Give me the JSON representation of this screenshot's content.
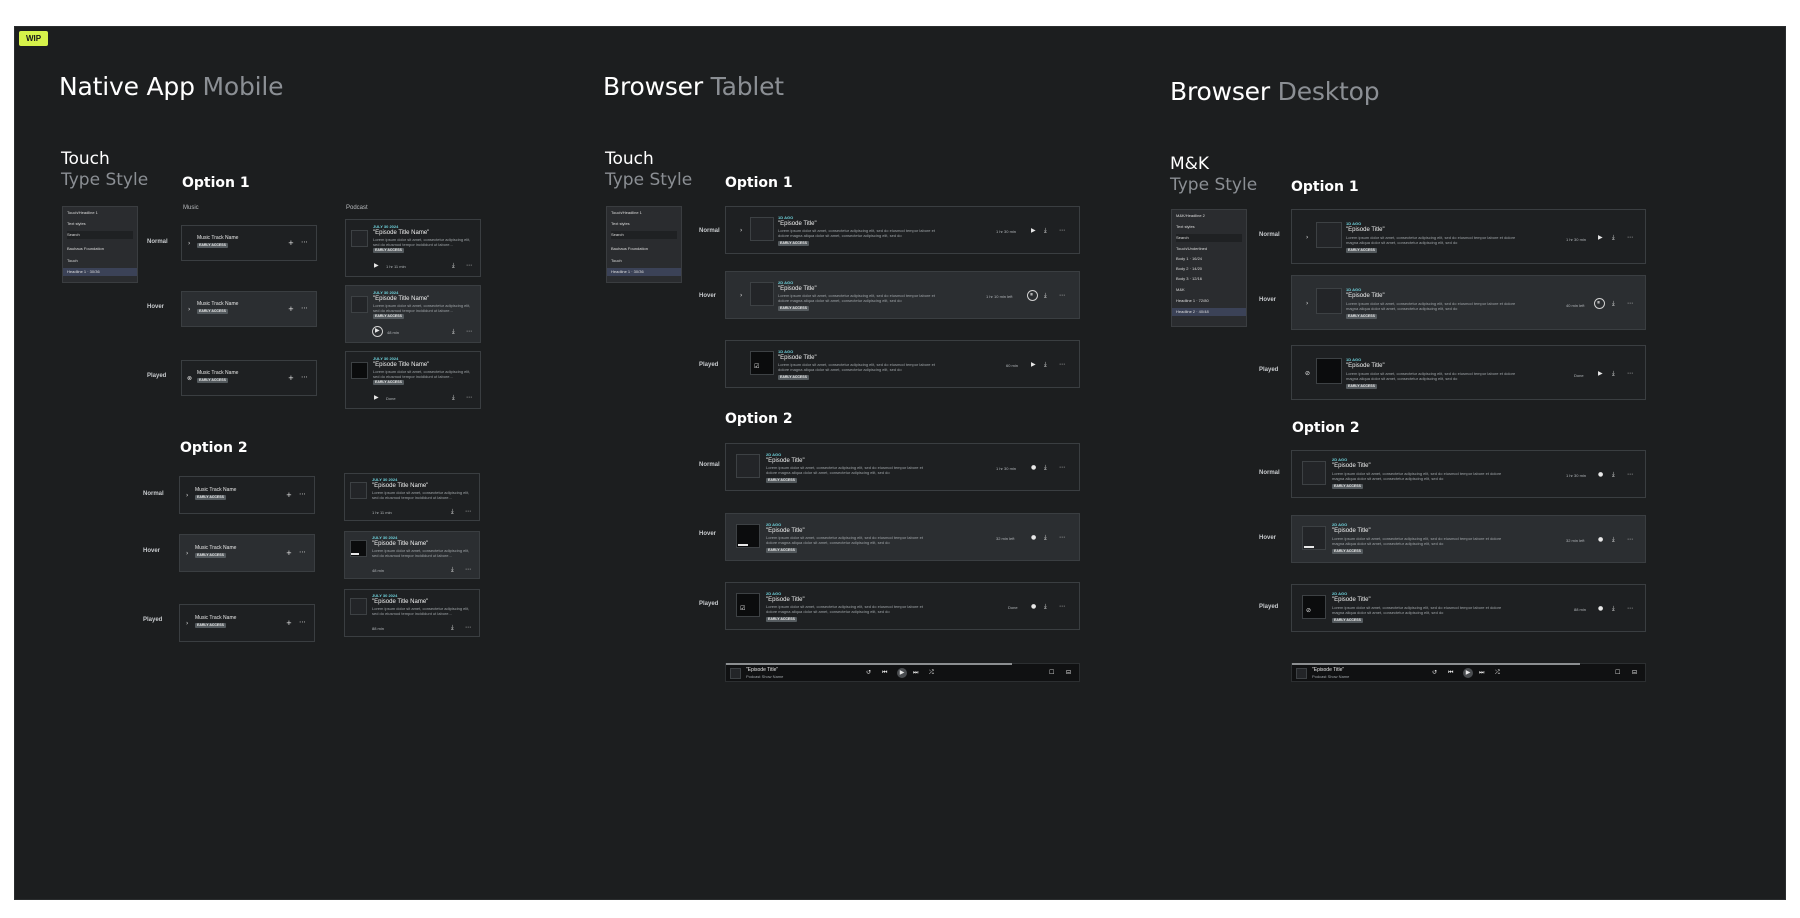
{
  "wip": "WIP",
  "sections": {
    "mobile": {
      "title_bold": "Native App",
      "title_light": "Mobile",
      "sub_bold": "Touch",
      "sub_light": "Type Style"
    },
    "tablet": {
      "title_bold": "Browser",
      "title_light": "Tablet",
      "sub_bold": "Touch",
      "sub_light": "Type Style"
    },
    "desktop": {
      "title_bold": "Browser",
      "title_light": "Desktop",
      "sub_bold": "M&K",
      "sub_light": "Type Style"
    }
  },
  "options": {
    "one": "Option 1",
    "two": "Option 2"
  },
  "states": {
    "normal": "Normal",
    "hover": "Hover",
    "played": "Played"
  },
  "columns": {
    "music": "Music",
    "podcast": "Podcast"
  },
  "mobile_panel": {
    "header": "Touch/Headline 1",
    "text_styles": "Text styles",
    "search": "Search",
    "foundation": "Bauhaus Foundation",
    "touch": "Touch",
    "selected": "Headline 1 · 30/36"
  },
  "tablet_panel": {
    "header": "Touch/Headline 1",
    "text_styles": "Text styles",
    "search": "Search",
    "foundation": "Bauhaus Foundation",
    "touch": "Touch",
    "selected": "Headline 1 · 30/36"
  },
  "desktop_panel": {
    "header": "M&K/Headline 2",
    "text_styles": "Text styles",
    "search": "Search",
    "group": "Touch/Underlined",
    "b1": "Body 1 · 16/24",
    "b2": "Body 2 · 14/20",
    "b3": "Body 3 · 12/16",
    "mk": "M&K",
    "h1": "Headline 1 · 72/80",
    "h2": "Headline 2 · 40/48"
  },
  "music": {
    "name": "Music Track Name",
    "badge": "EARLY ACCESS"
  },
  "podcast": {
    "date": "JULY 30 2024",
    "title": "\"Episode Title Name\"",
    "desc": "Lorem ipsum dolor sit amet, consectetur adipiscing elit, sed do eiusmod tempor incididunt ut labore...",
    "badge": "EARLY ACCESS",
    "dur_normal": "1 hr 11 min",
    "dur_hover": "48 min",
    "dur_played": "Done",
    "o2_played": "88 min"
  },
  "episode": {
    "title": "\"Episode Title\"",
    "desc": "Lorem ipsum dolor sit amet, consectetur adipiscing elit, sed do eiusmod tempor labore et dolore magna aliqua dolor sit amet, consectetur adipiscing elit, sed do",
    "badge": "EARLY ACCESS"
  },
  "tablet_eps": {
    "date1": "1D AGO",
    "date2": "2D AGO",
    "date3": "1D AGO",
    "dur1": "1 hr 30 min",
    "dur2": "1 hr 10 min left",
    "dur3": "60 min",
    "o2_date": "2D AGO",
    "o2_dur1": "1 hr 30 min",
    "o2_dur2": "32 min left",
    "o2_dur3": "Done"
  },
  "desktop_eps": {
    "date": "1D AGO",
    "dur1": "1 hr 30 min",
    "dur2": "40 min left",
    "dur3": "Done",
    "o2_date": "2D AGO",
    "o2_dur1": "1 hr 30 min",
    "o2_dur2": "32 min left",
    "o2_dur3": "88 min"
  },
  "player": {
    "title": "\"Episode Title\"",
    "show": "Podcast Show Name"
  },
  "colors": {
    "canvas": "#1c1e1f",
    "accent_green": "#d6f24a",
    "date_teal": "#6fd3dd",
    "card_border": "#3a3e41",
    "hover_bg": "#2b2e31"
  },
  "icons": {
    "play": "play-icon",
    "download": "download-icon",
    "more": "more-icon",
    "add": "plus-icon",
    "chevron": "chevron-icon",
    "check": "check-icon"
  }
}
